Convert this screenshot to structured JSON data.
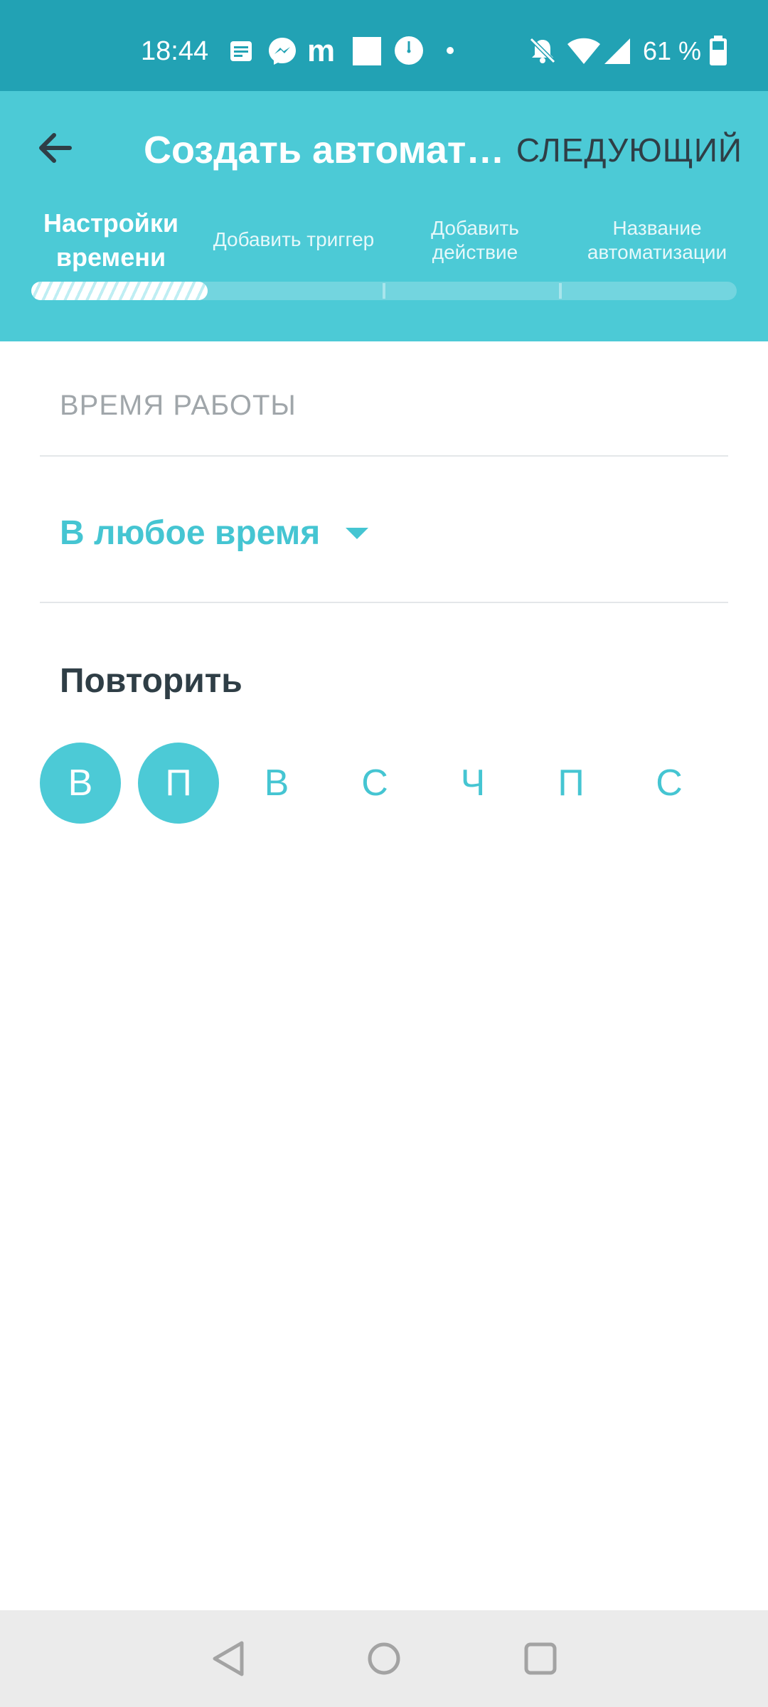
{
  "status_bar": {
    "time": "18:44",
    "battery_text": "61 %",
    "icons": [
      "notes-icon",
      "messenger-icon",
      "m-app-icon",
      "square-app-icon",
      "clock-icon",
      "dot-icon",
      "bell-off-icon",
      "wifi-icon",
      "signal-icon",
      "battery-icon"
    ]
  },
  "header": {
    "title": "Создать автоматизацию",
    "next_label": "СЛЕДУЮЩИЙ",
    "back_icon": "arrow-left-icon",
    "steps": [
      {
        "label": "Настройки времени"
      },
      {
        "label": "Добавить триггер"
      },
      {
        "label": "Добавить действие"
      },
      {
        "label": "Название автоматизации"
      }
    ],
    "current_step": 1,
    "total_steps": 4
  },
  "content": {
    "section_label": "ВРЕМЯ РАБОТЫ",
    "time_value": "В любое время",
    "repeat_label": "Повторить",
    "days": [
      {
        "label": "В",
        "selected": true
      },
      {
        "label": "П",
        "selected": true
      },
      {
        "label": "В",
        "selected": false
      },
      {
        "label": "С",
        "selected": false
      },
      {
        "label": "Ч",
        "selected": false
      },
      {
        "label": "П",
        "selected": false
      },
      {
        "label": "С",
        "selected": false
      }
    ]
  },
  "colors": {
    "status_bar": "#22a2b4",
    "header": "#4ccad6",
    "accent": "#45c5d2",
    "dark_text": "#2f3e46",
    "nav_bar": "#ebebeb"
  },
  "nav_bar": {
    "icons": [
      "back-triangle-icon",
      "home-circle-icon",
      "recents-square-icon"
    ]
  }
}
